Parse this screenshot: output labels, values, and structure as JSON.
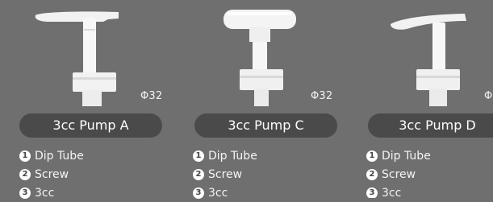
{
  "products": [
    {
      "name": "3cc Pump A",
      "diameter": "Φ32",
      "specs": [
        {
          "num": "1",
          "label": "Dip Tube"
        },
        {
          "num": "2",
          "label": "Screw"
        },
        {
          "num": "3",
          "label": "3cc"
        }
      ]
    },
    {
      "name": "3cc Pump C",
      "diameter": "Φ32",
      "specs": [
        {
          "num": "1",
          "label": "Dip Tube"
        },
        {
          "num": "2",
          "label": "Screw"
        },
        {
          "num": "3",
          "label": "3cc"
        }
      ]
    },
    {
      "name": "3cc Pump D",
      "diameter": "Φ",
      "specs": [
        {
          "num": "1",
          "label": "Dip Tube"
        },
        {
          "num": "2",
          "label": "Screw"
        },
        {
          "num": "3",
          "label": "3cc"
        }
      ]
    }
  ]
}
